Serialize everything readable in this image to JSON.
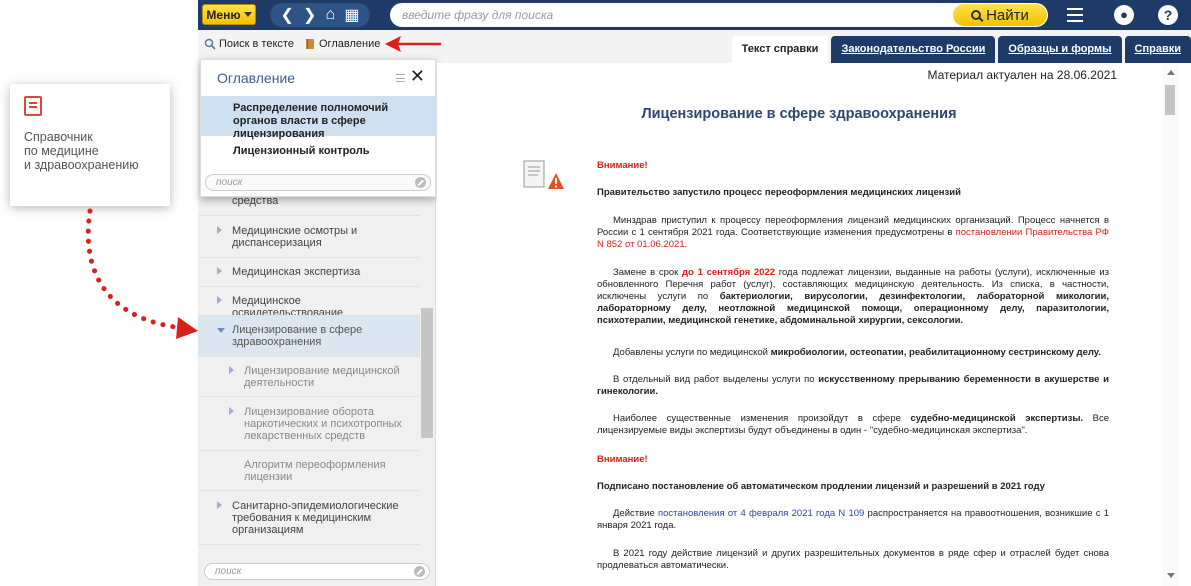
{
  "annotation": {
    "card_title": "Справочник\nпо медицине\nи здравоохранению"
  },
  "topbar": {
    "menu_label": "Меню",
    "search_placeholder": "введите фразу для поиска",
    "find_label": "Найти"
  },
  "subbar": {
    "search_in_text": "Поиск в тексте",
    "contents": "Оглавление",
    "tabs": [
      {
        "label": "Текст справки",
        "active": true
      },
      {
        "label": "Законодательство России",
        "active": false
      },
      {
        "label": "Образцы и формы",
        "active": false
      },
      {
        "label": "Справки",
        "active": false
      }
    ]
  },
  "popup": {
    "title": "Оглавление",
    "items": [
      "Распределение полномочий органов власти в сфере лицензирования",
      "Лицензионный контроль"
    ],
    "search_placeholder": "поиск"
  },
  "toc": {
    "items": [
      {
        "label": "средства",
        "level": 0
      },
      {
        "label": "Медицинские осмотры и диспансеризация",
        "level": 0
      },
      {
        "label": "Медицинская экспертиза",
        "level": 0
      },
      {
        "label": "Медицинское освидетельствование",
        "level": 0
      },
      {
        "label": "Лицензирование в сфере здравоохранения",
        "level": 0,
        "open": true
      },
      {
        "label": "Лицензирование медицинской деятельности",
        "level": 1
      },
      {
        "label": "Лицензирование оборота наркотических и психотропных лекарственных средств",
        "level": 1
      },
      {
        "label": "Алгоритм переоформления лицензии",
        "level": 1
      },
      {
        "label": "Санитарно-эпидемиологические требования к медицинским организациям",
        "level": 0
      }
    ],
    "search_placeholder": "поиск"
  },
  "doc": {
    "actual": "Материал актуален на 28.06.2021",
    "title": "Лицензирование в сфере здравоохранения",
    "attention1": "Внимание!",
    "heading1": "Правительство запустило процесс переоформления медицинских лицензий",
    "p1_a": "Минздрав приступил к процессу переоформления лицензий медицинских организаций. Процесс начнется в России с 1 сентября 2021 года. Соответствующие изменения предусмотрены в ",
    "p1_link": "постановлении Правительства РФ N 852 от 01.06.2021",
    "p1_b": ".",
    "p2_a": "Замене в срок ",
    "p2_red": "до 1 сентября 2022",
    "p2_b": " года подлежат лицензии, выданные на работы (услуги), исключенные из обновленного Перечня работ (услуг), составляющих медицинскую деятельность. Из списка, в частности, исключены услуги по ",
    "p2_bold": "бактериологии, вирусологии, дезинфектологии, лабораторной микологии, лабораторному делу, неотложной медицинской помощи, операционному делу, паразитологии, психотерапии, медицинской генетике, абдоминальной хирургии, сексологии.",
    "p3_a": "Добавлены услуги по медицинской ",
    "p3_bold": "микробиологии, остеопатии, реабилитационному сестринскому делу.",
    "p4_a": "В отдельный вид работ выделены услуги по ",
    "p4_bold": "искусственному прерыванию беременности в акушерстве и гинекологии.",
    "p5_a": "Наиболее существенные изменения произойдут в сфере ",
    "p5_bold": "судебно-медицинской экспертизы.",
    "p5_b": " Все лицензируемые виды экспертизы будут объединены в один - \"судебно-медицинская экспертиза\".",
    "attention2": "Внимание!",
    "heading2": "Подписано постановление об автоматическом продлении лицензий и разрешений в 2021 году",
    "p6_a": "Действие ",
    "p6_link": "постановления от 4 февраля 2021 года N 109",
    "p6_b": " распространяется на правоотношения, возникшие с 1 января 2021 года.",
    "p7": "В 2021 году действие лицензий и других разрешительных документов в ряде сфер и отраслей будет снова продлеваться автоматически."
  }
}
